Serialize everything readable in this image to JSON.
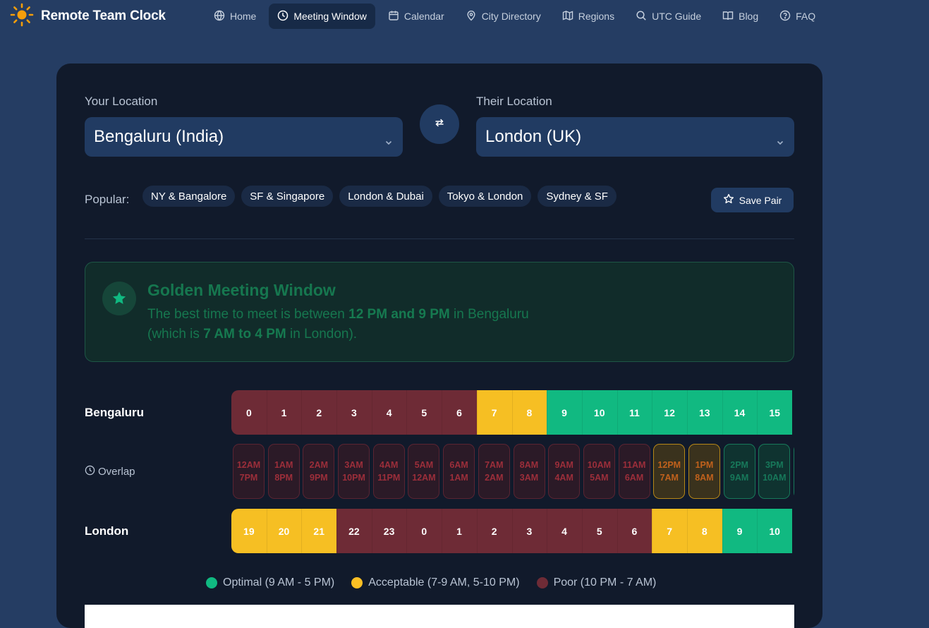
{
  "brand": {
    "title": "Remote Team Clock",
    "accent": "#f59e0b"
  },
  "nav": [
    {
      "label": "Home",
      "icon": "globe-icon",
      "active": false
    },
    {
      "label": "Meeting Window",
      "icon": "clock-icon",
      "active": true
    },
    {
      "label": "Calendar",
      "icon": "calendar-icon",
      "active": false
    },
    {
      "label": "City Directory",
      "icon": "map-pin-icon",
      "active": false
    },
    {
      "label": "Regions",
      "icon": "map-icon",
      "active": false
    },
    {
      "label": "UTC Guide",
      "icon": "search-icon",
      "active": false
    },
    {
      "label": "Blog",
      "icon": "book-icon",
      "active": false
    },
    {
      "label": "FAQ",
      "icon": "help-circle-icon",
      "active": false
    }
  ],
  "your_location": {
    "label": "Your Location",
    "value": "Bengaluru (India)"
  },
  "their_location": {
    "label": "Their Location",
    "value": "London (UK)"
  },
  "popular": {
    "label": "Popular:",
    "chips": [
      "NY & Bangalore",
      "SF & Singapore",
      "London & Dubai",
      "Tokyo & London",
      "Sydney & SF"
    ]
  },
  "save_pair": {
    "label": "Save Pair"
  },
  "golden": {
    "title": "Golden Meeting Window",
    "line1_pre": "The best time to meet is between ",
    "line1_bold": "12 PM and 9 PM",
    "line1_post": " in Bengaluru",
    "line2_pre": "(which is ",
    "line2_bold": "7 AM to 4 PM",
    "line2_post": " in London)."
  },
  "timeline": {
    "top": {
      "label": "Bengaluru",
      "cells": [
        {
          "v": "0",
          "s": "poor"
        },
        {
          "v": "1",
          "s": "poor"
        },
        {
          "v": "2",
          "s": "poor"
        },
        {
          "v": "3",
          "s": "poor"
        },
        {
          "v": "4",
          "s": "poor"
        },
        {
          "v": "5",
          "s": "poor"
        },
        {
          "v": "6",
          "s": "poor"
        },
        {
          "v": "7",
          "s": "acc"
        },
        {
          "v": "8",
          "s": "acc"
        },
        {
          "v": "9",
          "s": "opt"
        },
        {
          "v": "10",
          "s": "opt"
        },
        {
          "v": "11",
          "s": "opt"
        },
        {
          "v": "12",
          "s": "opt"
        },
        {
          "v": "13",
          "s": "opt"
        },
        {
          "v": "14",
          "s": "opt"
        },
        {
          "v": "15",
          "s": "opt"
        }
      ]
    },
    "overlap": {
      "label": "Overlap",
      "cells": [
        {
          "a": "12AM",
          "b": "7PM",
          "s": "poor"
        },
        {
          "a": "1AM",
          "b": "8PM",
          "s": "poor"
        },
        {
          "a": "2AM",
          "b": "9PM",
          "s": "poor"
        },
        {
          "a": "3AM",
          "b": "10PM",
          "s": "poor"
        },
        {
          "a": "4AM",
          "b": "11PM",
          "s": "poor"
        },
        {
          "a": "5AM",
          "b": "12AM",
          "s": "poor"
        },
        {
          "a": "6AM",
          "b": "1AM",
          "s": "poor"
        },
        {
          "a": "7AM",
          "b": "2AM",
          "s": "poor"
        },
        {
          "a": "8AM",
          "b": "3AM",
          "s": "poor"
        },
        {
          "a": "9AM",
          "b": "4AM",
          "s": "poor"
        },
        {
          "a": "10AM",
          "b": "5AM",
          "s": "poor"
        },
        {
          "a": "11AM",
          "b": "6AM",
          "s": "poor"
        },
        {
          "a": "12PM",
          "b": "7AM",
          "s": "acc"
        },
        {
          "a": "1PM",
          "b": "8AM",
          "s": "acc"
        },
        {
          "a": "2PM",
          "b": "9AM",
          "s": "opt"
        },
        {
          "a": "3PM",
          "b": "10AM",
          "s": "opt"
        },
        {
          "a": "",
          "b": "",
          "s": "opt"
        }
      ]
    },
    "bottom": {
      "label": "London",
      "cells": [
        {
          "v": "19",
          "s": "acc"
        },
        {
          "v": "20",
          "s": "acc"
        },
        {
          "v": "21",
          "s": "acc"
        },
        {
          "v": "22",
          "s": "poor"
        },
        {
          "v": "23",
          "s": "poor"
        },
        {
          "v": "0",
          "s": "poor"
        },
        {
          "v": "1",
          "s": "poor"
        },
        {
          "v": "2",
          "s": "poor"
        },
        {
          "v": "3",
          "s": "poor"
        },
        {
          "v": "4",
          "s": "poor"
        },
        {
          "v": "5",
          "s": "poor"
        },
        {
          "v": "6",
          "s": "poor"
        },
        {
          "v": "7",
          "s": "acc"
        },
        {
          "v": "8",
          "s": "acc"
        },
        {
          "v": "9",
          "s": "opt"
        },
        {
          "v": "10",
          "s": "opt"
        }
      ]
    }
  },
  "legend": [
    {
      "label": "Optimal (9 AM - 5 PM)",
      "color": "#10b981"
    },
    {
      "label": "Acceptable (7-9 AM, 5-10 PM)",
      "color": "#fbbf24"
    },
    {
      "label": "Poor (10 PM - 7 AM)",
      "color": "#6e2b36"
    }
  ]
}
